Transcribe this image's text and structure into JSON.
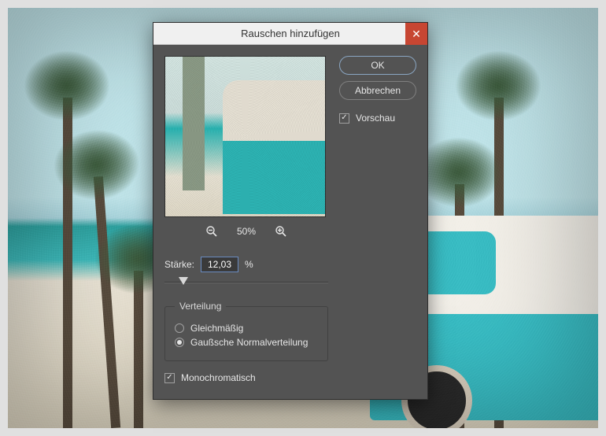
{
  "dialog": {
    "title": "Rauschen hinzufügen",
    "buttons": {
      "ok": "OK",
      "cancel": "Abbrechen"
    },
    "preview_checkbox": {
      "label": "Vorschau",
      "checked": true
    },
    "zoom": {
      "level": "50%"
    },
    "amount": {
      "label": "Stärke:",
      "value": "12,03",
      "unit": "%"
    },
    "distribution": {
      "legend": "Verteilung",
      "options": {
        "uniform": {
          "label": "Gleichmäßig",
          "selected": false
        },
        "gaussian": {
          "label": "Gaußsche Normalverteilung",
          "selected": true
        }
      }
    },
    "monochromatic": {
      "label": "Monochromatisch",
      "checked": true
    }
  },
  "icons": {
    "close": "✕",
    "zoom_out": "−",
    "zoom_in": "+"
  }
}
